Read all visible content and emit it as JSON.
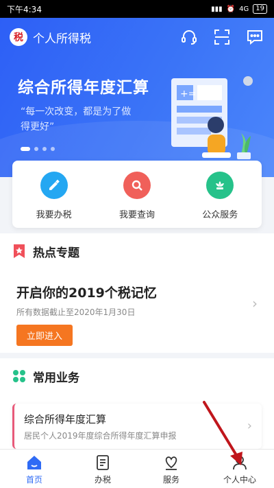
{
  "status_bar": {
    "time": "下午4:34",
    "network": "4G",
    "battery": "19"
  },
  "app": {
    "title": "个人所得税",
    "logo_icon": "tax-emblem-icon"
  },
  "header_icons": [
    "headset-icon",
    "scan-icon",
    "message-icon"
  ],
  "banner": {
    "title": "综合所得年度汇算",
    "subtitle": "“每一次改变，都是为了做得更好”",
    "page_count": 4,
    "active_page": 1
  },
  "quick_actions": [
    {
      "label": "我要办税",
      "icon": "pencil-icon",
      "color": "#24a7f2"
    },
    {
      "label": "我要查询",
      "icon": "search-icon",
      "color": "#f0605a"
    },
    {
      "label": "公众服务",
      "icon": "flower-icon",
      "color": "#26c28a"
    }
  ],
  "hot_topics": {
    "section_title": "热点专题",
    "headline": "开启你的2019个税记忆",
    "subtext": "所有数据截止至2020年1月30日",
    "button_label": "立即进入",
    "accent": "#f57621"
  },
  "common_business": {
    "section_title": "常用业务",
    "item_title": "综合所得年度汇算",
    "item_subtitle": "居民个人2019年度综合所得年度汇算申报"
  },
  "bottom_nav": [
    {
      "label": "首页",
      "icon": "home-icon",
      "active": true
    },
    {
      "label": "办税",
      "icon": "document-icon",
      "active": false
    },
    {
      "label": "服务",
      "icon": "heart-hands-icon",
      "active": false
    },
    {
      "label": "个人中心",
      "icon": "user-icon",
      "active": false
    }
  ],
  "colors": {
    "primary": "#2f6bf5",
    "orange": "#f57621"
  }
}
